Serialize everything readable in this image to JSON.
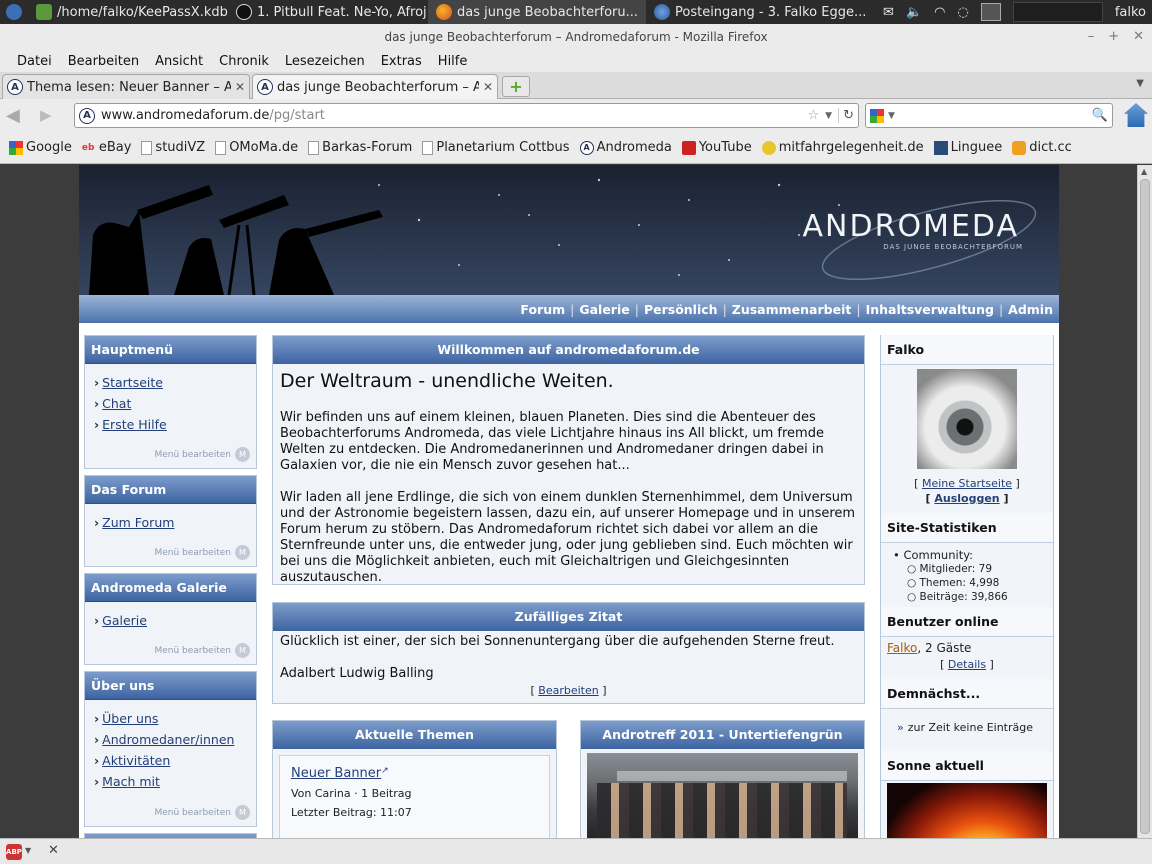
{
  "taskbar": {
    "items": [
      {
        "label": "/home/falko/KeePassX.kdb...",
        "icon": "keepass-icon"
      },
      {
        "label": "1. Pitbull Feat. Ne-Yo, Afroj...",
        "icon": "media-player-icon"
      },
      {
        "label": "das junge Beobachterforu...",
        "icon": "firefox-icon"
      },
      {
        "label": "Posteingang - 3. Falko Egge...",
        "icon": "thunderbird-icon"
      }
    ],
    "user": "falko"
  },
  "window": {
    "title": "das junge Beobachterforum – Andromedaforum - Mozilla Firefox"
  },
  "menubar": {
    "items": [
      "Datei",
      "Bearbeiten",
      "Ansicht",
      "Chronik",
      "Lesezeichen",
      "Extras",
      "Hilfe"
    ]
  },
  "tabs": [
    {
      "label": "Thema lesen: Neuer Banner – A...",
      "active": false
    },
    {
      "label": "das junge Beobachterforum – A...",
      "active": true
    }
  ],
  "urlbar": {
    "host": "www.andromedaforum.de",
    "path": "/pg/start"
  },
  "bookmarks": [
    {
      "label": "Google",
      "icon": "google-icon"
    },
    {
      "label": "eBay",
      "icon": "ebay-icon"
    },
    {
      "label": "studiVZ",
      "icon": "page-icon"
    },
    {
      "label": "OMoMa.de",
      "icon": "page-icon"
    },
    {
      "label": "Barkas-Forum",
      "icon": "page-icon"
    },
    {
      "label": "Planetarium Cottbus",
      "icon": "page-icon"
    },
    {
      "label": "Andromeda",
      "icon": "andromeda-icon"
    },
    {
      "label": "YouTube",
      "icon": "youtube-icon"
    },
    {
      "label": "mitfahrgelegenheit.de",
      "icon": "mitfahr-icon"
    },
    {
      "label": "Linguee",
      "icon": "linguee-icon"
    },
    {
      "label": "dict.cc",
      "icon": "dictcc-icon"
    }
  ],
  "site": {
    "logo": "ANDROMEDA",
    "logo_sub": "DAS JUNGE BEOBACHTERFORUM",
    "nav": [
      "Forum",
      "Galerie",
      "Persönlich",
      "Zusammenarbeit",
      "Inhaltsverwaltung",
      "Admin"
    ]
  },
  "left": [
    {
      "title": "Hauptmenü",
      "items": [
        "Startseite",
        "Chat",
        "Erste Hilfe"
      ],
      "edit": "Menü bearbeiten"
    },
    {
      "title": "Das Forum",
      "items": [
        "Zum Forum"
      ],
      "edit": "Menü bearbeiten"
    },
    {
      "title": "Andromeda Galerie",
      "items": [
        "Galerie"
      ],
      "edit": "Menü bearbeiten"
    },
    {
      "title": "Über uns",
      "items": [
        "Über uns",
        "Andromedaner/innen",
        "Aktivitäten",
        "Mach mit"
      ],
      "edit": "Menü bearbeiten"
    }
  ],
  "welcome": {
    "header": "Willkommen auf andromedaforum.de",
    "heading": "Der Weltraum - unendliche Weiten.",
    "p1": "Wir befinden uns auf einem kleinen, blauen Planeten. Dies sind die Abenteuer des Beobachterforums Andromeda, das viele Lichtjahre hinaus ins All blickt, um fremde Welten zu entdecken. Die Andromedanerinnen und Andromedaner dringen dabei in Galaxien vor, die nie ein Mensch zuvor gesehen hat...",
    "p2": "Wir laden all jene Erdlinge, die sich von einem dunklen Sternenhimmel, dem Universum und der Astronomie begeistern lassen, dazu ein, auf unserer Homepage und in unserem Forum herum zu stöbern. Das Andromedaforum richtet sich dabei vor allem an die Sternfreunde unter uns, die entweder jung, oder jung geblieben sind. Euch möchten wir bei uns die Möglichkeit anbieten, euch mit Gleichaltrigen und Gleichgesinnten auszutauschen."
  },
  "quote": {
    "header": "Zufälliges Zitat",
    "text": "Glücklich ist einer, der sich bei Sonnenuntergang über die aufgehenden Sterne freut.",
    "author": "Adalbert Ludwig Balling",
    "edit": "Bearbeiten"
  },
  "topics": {
    "header": "Aktuelle Themen",
    "item": {
      "title": "Neuer Banner",
      "meta": "Von Carina · 1 Beitrag",
      "last": "Letzter Beitrag: 11:07"
    }
  },
  "androtreff": {
    "header": "Androtreff 2011 - Untertiefengrün"
  },
  "right": {
    "user": {
      "name": "Falko",
      "link1": "Meine Startseite",
      "link2": "Ausloggen"
    },
    "stats": {
      "title": "Site-Statistiken",
      "community": "Community:",
      "members": "Mitglieder: 79",
      "topics": "Themen: 4,998",
      "posts": "Beiträge: 39,866"
    },
    "online": {
      "title": "Benutzer online",
      "user": "Falko",
      "guests": ", 2 Gäste",
      "details": "Details"
    },
    "soon": {
      "title": "Demnächst...",
      "text": "zur Zeit keine Einträge"
    },
    "sun": {
      "title": "Sonne aktuell"
    }
  },
  "colors": {
    "header_blue": "#3d64a1",
    "link": "#233f7a",
    "box_bg": "#f0f3f8"
  }
}
